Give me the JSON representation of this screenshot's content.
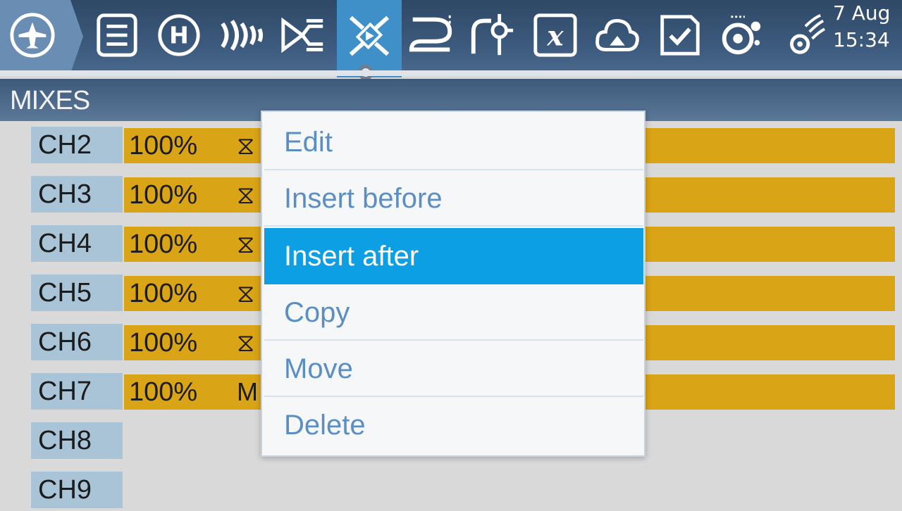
{
  "topbar": {
    "date": "7 Aug",
    "time": "15:34",
    "icons": [
      "model-setup-icon",
      "list-icon",
      "heli-icon",
      "flight-modes-icon",
      "inputs-icon",
      "mixes-icon",
      "outputs-icon",
      "curves-icon",
      "logical-switches-icon",
      "special-functions-icon",
      "telemetry-icon",
      "checklist-icon",
      "radio-settings-icon",
      "signal-icon"
    ],
    "active": "mixes-icon"
  },
  "title": "MIXES",
  "channels": [
    {
      "name": "CH2",
      "weight": "100%",
      "source": "⧖"
    },
    {
      "name": "CH3",
      "weight": "100%",
      "source": "⧖"
    },
    {
      "name": "CH4",
      "weight": "100%",
      "source": "⧖"
    },
    {
      "name": "CH5",
      "weight": "100%",
      "source": "⧖"
    },
    {
      "name": "CH6",
      "weight": "100%",
      "source": "⧖"
    },
    {
      "name": "CH7",
      "weight": "100%",
      "source": "M"
    },
    {
      "name": "CH8",
      "weight": "",
      "source": ""
    },
    {
      "name": "CH9",
      "weight": "",
      "source": ""
    }
  ],
  "menu": {
    "items": [
      "Edit",
      "Insert before",
      "Insert after",
      "Copy",
      "Move",
      "Delete"
    ],
    "selected": "Insert after"
  },
  "colors": {
    "accent": "#0d9fe3",
    "bar": "#d9a416",
    "channel_label_bg": "#a9c4d6"
  }
}
